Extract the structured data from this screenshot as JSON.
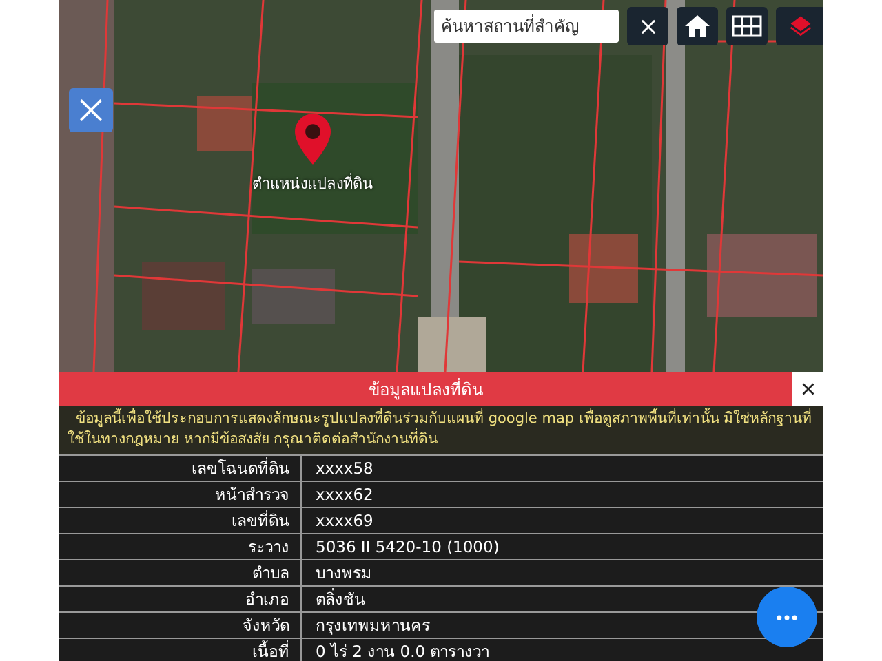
{
  "search": {
    "placeholder": "ค้นหาสถานที่สำคัญ"
  },
  "marker": {
    "label": "ตำแหน่งแปลงที่ดิน"
  },
  "panel": {
    "title": "ข้อมูลแปลงที่ดิน",
    "disclaimer": "ข้อมูลนี้เพื่อใช้ประกอบการแสดงลักษณะรูปแปลงที่ดินร่วมกับแผนที่ google map เพื่อดูสภาพพื้นที่เท่านั้น มิใช่หลักฐานที่ใช้ในทางกฎหมาย หากมีข้อสงสัย กรุณาติดต่อสำนักงานที่ดิน",
    "rows": [
      {
        "label": "เลขโฉนดที่ดิน",
        "value": "xxxx58"
      },
      {
        "label": "หน้าสำรวจ",
        "value": "xxxx62"
      },
      {
        "label": "เลขที่ดิน",
        "value": "xxxx69"
      },
      {
        "label": "ระวาง",
        "value": "5036 II 5420-10 (1000)"
      },
      {
        "label": "ตำบล",
        "value": "บางพรม"
      },
      {
        "label": "อำเภอ",
        "value": "ตลิ่งชัน"
      },
      {
        "label": "จังหวัด",
        "value": "กรุงเทพมหานคร"
      },
      {
        "label": "เนื้อที่",
        "value": "0 ไร่ 2 งาน 0.0 ตารางวา"
      }
    ]
  }
}
